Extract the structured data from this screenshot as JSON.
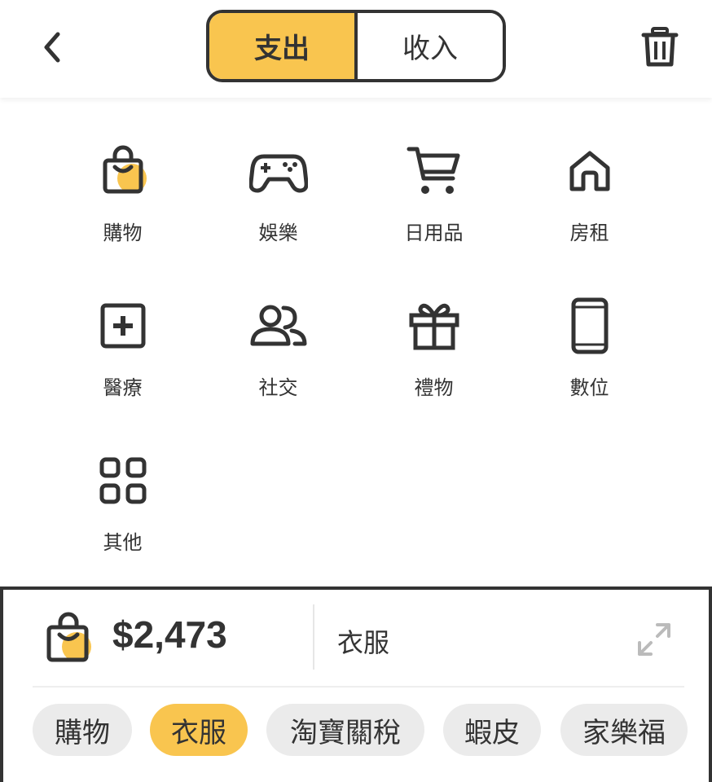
{
  "header": {
    "tabs": [
      {
        "label": "支出",
        "active": true
      },
      {
        "label": "收入",
        "active": false
      }
    ],
    "back_icon": "chevron-left-icon",
    "delete_icon": "trash-icon"
  },
  "categories": [
    {
      "label": "購物",
      "icon": "shopping-bag-icon",
      "selected": true
    },
    {
      "label": "娛樂",
      "icon": "gamepad-icon",
      "selected": false
    },
    {
      "label": "日用品",
      "icon": "shopping-cart-icon",
      "selected": false
    },
    {
      "label": "房租",
      "icon": "home-icon",
      "selected": false
    },
    {
      "label": "醫療",
      "icon": "medical-plus-icon",
      "selected": false
    },
    {
      "label": "社交",
      "icon": "people-icon",
      "selected": false
    },
    {
      "label": "禮物",
      "icon": "gift-icon",
      "selected": false
    },
    {
      "label": "數位",
      "icon": "smartphone-icon",
      "selected": false
    },
    {
      "label": "其他",
      "icon": "grid-icon",
      "selected": false
    }
  ],
  "entry": {
    "amount": "$2,473",
    "note": "衣服",
    "icon": "shopping-bag-icon",
    "expand_icon": "expand-icon"
  },
  "subcategories": [
    {
      "label": "購物",
      "active": false
    },
    {
      "label": "衣服",
      "active": true
    },
    {
      "label": "淘寶關稅",
      "active": false
    },
    {
      "label": "蝦皮",
      "active": false
    },
    {
      "label": "家樂福",
      "active": false
    }
  ],
  "colors": {
    "accent": "#f9c54f",
    "ink": "#333333",
    "chip_bg": "#ebebeb"
  }
}
